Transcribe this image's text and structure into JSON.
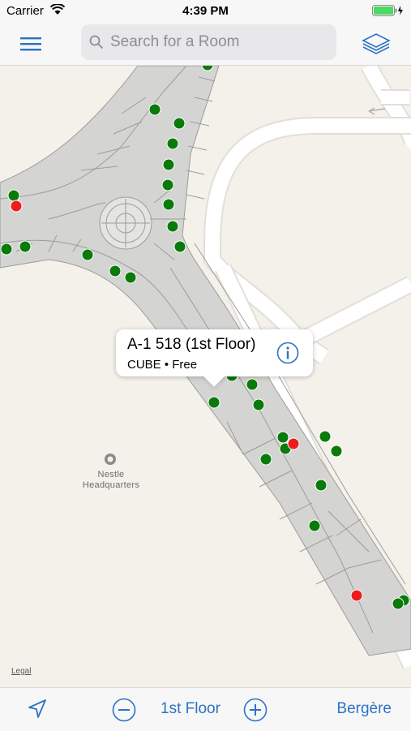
{
  "status_bar": {
    "carrier": "Carrier",
    "time": "4:39 PM"
  },
  "nav": {
    "search_placeholder": "Search for a Room"
  },
  "callout": {
    "title": "A-1 518 (1st Floor)",
    "subtitle": "CUBE • Free"
  },
  "map": {
    "poi_label": "Nestle Headquarters",
    "legal": "Legal",
    "colors": {
      "free": "#0a7a0a",
      "busy": "#ee1c1c",
      "building": "#d6d6d4",
      "road": "#ffffff"
    }
  },
  "bottom_bar": {
    "floor_label": "1st Floor",
    "building_label": "Bergère"
  },
  "colors": {
    "accent": "#2b73c3"
  }
}
